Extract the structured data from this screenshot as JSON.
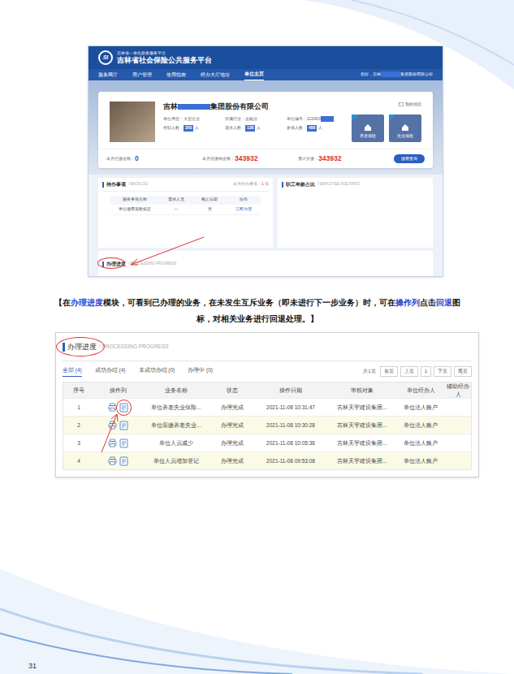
{
  "page": {
    "number": "31"
  },
  "screenshot1": {
    "header": {
      "logo": "SI",
      "subtitle": "吉林省一体化政务服务平台",
      "title": "吉林省社会保险公共服务平台"
    },
    "nav": [
      {
        "label": "服务网厅",
        "selected": false
      },
      {
        "label": "用户管理",
        "selected": false
      },
      {
        "label": "使用指南",
        "selected": false
      },
      {
        "label": "经办大厅地址",
        "selected": false
      },
      {
        "label": "单位主页",
        "selected": true
      }
    ],
    "greeting": {
      "prefix": "您好，吉林",
      "suffix": "集团股份有限公司",
      "redacted": true
    },
    "company": {
      "name_prefix": "吉林",
      "name_suffix": "集团股份有限公司",
      "redacted": true,
      "messages": "我的消息",
      "fields": [
        {
          "label": "单位类型：",
          "value": "大型企业",
          "redacted": false
        },
        {
          "label": "所属行业：",
          "value": "金融业",
          "redacted": false
        },
        {
          "label": "单位编号：",
          "value": "222400",
          "redacted": true
        }
      ],
      "counts": [
        {
          "label": "在职人数：",
          "value": "350",
          "unit": "人"
        },
        {
          "label": "退休人数：",
          "value": "138",
          "unit": "人"
        },
        {
          "label": "参保人数：",
          "value": "488",
          "unit": "人"
        }
      ],
      "insurance": [
        {
          "label": "养老保险"
        },
        {
          "label": "失业保险"
        }
      ]
    },
    "stats": [
      {
        "label": "本月已缴金额：",
        "value": "0",
        "color": "#1f5fbf"
      },
      {
        "label": "本月应缴纳金额：",
        "value": "343932",
        "color": "#d9342b"
      },
      {
        "label": "累计欠缴：",
        "value": "343932",
        "color": "#d9342b"
      }
    ],
    "stats_button": "缴费查询",
    "backlog": {
      "title": "待办事项",
      "subtitle": "BACKLOG",
      "count_label": "本月待办事项：",
      "count": "1",
      "count_unit": "项",
      "columns": [
        "服务事项名称",
        "需求人员",
        "截止日期",
        "操作"
      ],
      "rows": [
        {
          "name": "单位缴费基数核定",
          "person": "—",
          "deadline": "无",
          "action": "立即办理"
        }
      ]
    },
    "age_panel": {
      "title": "职工年龄占比",
      "subtitle": "EMPLOYEE AGE RATIO"
    },
    "progress": {
      "title": "办理进度",
      "subtitle": "PROCESSING PROGRESS",
      "circled": true
    }
  },
  "caption": [
    {
      "text": "【在",
      "emphasis": false
    },
    {
      "text": "办理进度",
      "emphasis": true
    },
    {
      "text": "模块，可看到已办理的业务，在未发生互斥业务（即未进行下一步业务）时，可在",
      "emphasis": false
    },
    {
      "text": "操作列",
      "emphasis": true
    },
    {
      "text": "点击",
      "emphasis": false
    },
    {
      "text": "回退",
      "emphasis": true
    },
    {
      "text": "图标，对相关业务进行回退处理。】",
      "emphasis": false
    }
  ],
  "screenshot2": {
    "title": "办理进度",
    "subtitle": "PROCESSING PROGRESS",
    "circled": true,
    "tabs": [
      {
        "label": "全部 (4)",
        "selected": true
      },
      {
        "label": "成功办结 (4)",
        "selected": false
      },
      {
        "label": "未成功办结 (0)",
        "selected": false
      },
      {
        "label": "办理中 (0)",
        "selected": false
      }
    ],
    "pager": {
      "total": "共1页",
      "buttons": [
        "首页",
        "上页",
        "1",
        "下页",
        "尾页"
      ]
    },
    "columns": [
      "序号",
      "操作列",
      "业务名称",
      "状态",
      "操作日期",
      "审核对象",
      "单位经办人",
      "辅助经办人"
    ],
    "rows": [
      {
        "index": "1",
        "name": "单位养老失业保险...",
        "status": "办理完成",
        "date": "2021-11-08 10:31:47",
        "target": "吉林天宇建设集团...",
        "handler": "单位法人账户",
        "circled": true
      },
      {
        "index": "2",
        "name": "单位应缴养老失业...",
        "status": "办理完成",
        "date": "2021-11-08 10:30:28",
        "target": "吉林天宇建设集团...",
        "handler": "单位法人账户",
        "circled": false
      },
      {
        "index": "3",
        "name": "单位人员减少",
        "status": "办理完成",
        "date": "2021-11-08 10:05:36",
        "target": "吉林天宇建设集团...",
        "handler": "单位法人账户",
        "circled": false
      },
      {
        "index": "4",
        "name": "单位人员增加登记",
        "status": "办理完成",
        "date": "2021-11-08 09:53:08",
        "target": "吉林天宇建设集团...",
        "handler": "单位法人账户",
        "circled": false
      }
    ]
  }
}
